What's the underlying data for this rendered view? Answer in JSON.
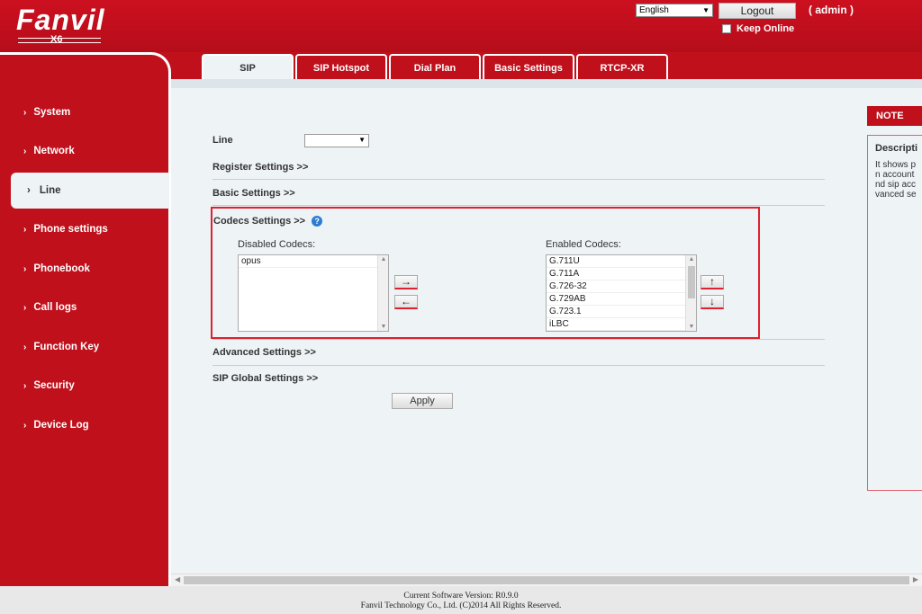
{
  "header": {
    "brand": "Fanvil",
    "model": "X6",
    "language": "English",
    "logout_label": "Logout",
    "user_label": "( admin )",
    "keep_online_label": "Keep Online"
  },
  "sidebar": {
    "items": [
      {
        "label": "System"
      },
      {
        "label": "Network"
      },
      {
        "label": "Line"
      },
      {
        "label": "Phone settings"
      },
      {
        "label": "Phonebook"
      },
      {
        "label": "Call logs"
      },
      {
        "label": "Function Key"
      },
      {
        "label": "Security"
      },
      {
        "label": "Device Log"
      }
    ],
    "active": "Line"
  },
  "tabs": [
    {
      "label": "SIP",
      "active": true
    },
    {
      "label": "SIP Hotspot"
    },
    {
      "label": "Dial Plan"
    },
    {
      "label": "Basic Settings"
    },
    {
      "label": "RTCP-XR"
    }
  ],
  "form": {
    "line_label": "Line",
    "line_value": "",
    "register_settings": "Register Settings >>",
    "basic_settings": "Basic Settings >>",
    "codecs_settings": "Codecs Settings >>",
    "disabled_codecs_label": "Disabled Codecs:",
    "enabled_codecs_label": "Enabled Codecs:",
    "disabled_codecs": [
      "opus"
    ],
    "enabled_codecs": [
      "G.711U",
      "G.711A",
      "G.726-32",
      "G.729AB",
      "G.723.1",
      "iLBC"
    ],
    "move_right": "→",
    "move_left": "←",
    "move_up": "↑",
    "move_down": "↓",
    "advanced_settings": "Advanced Settings >>",
    "sip_global_settings": "SIP Global Settings >>",
    "apply_label": "Apply"
  },
  "note": {
    "header": "NOTE",
    "title": "Descripti",
    "lines": [
      "It shows p",
      "n account",
      "nd sip acc",
      "vanced se"
    ]
  },
  "footer": {
    "version": "Current Software Version: R0.9.0",
    "copyright": "Fanvil Technology Co., Ltd. (C)2014 All Rights Reserved."
  }
}
